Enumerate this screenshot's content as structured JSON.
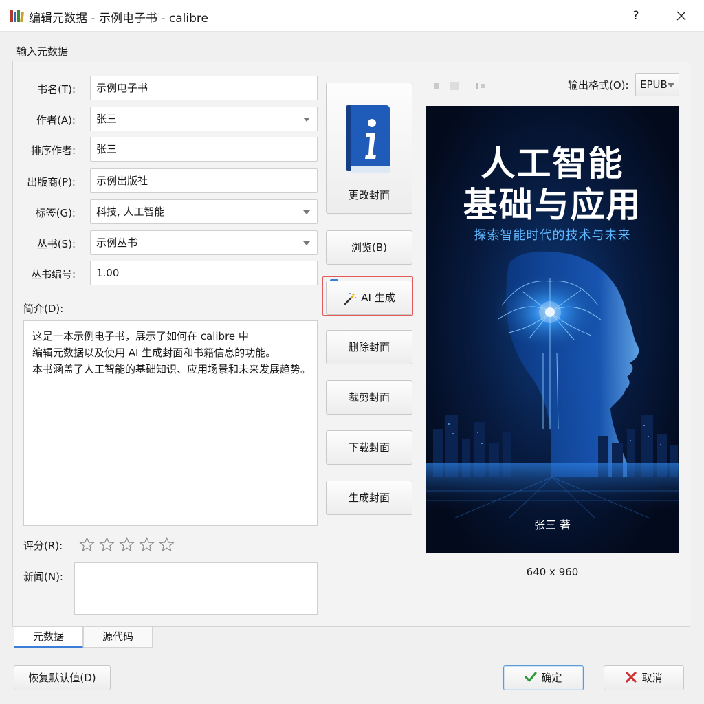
{
  "window": {
    "title": "编辑元数据 - 示例电子书 - calibre",
    "help": "?"
  },
  "section_label": "输入元数据",
  "form": {
    "title_label": "书名(T):",
    "title_value": "示例电子书",
    "author_label": "作者(A):",
    "author_value": "张三",
    "sort_author_label": "排序作者:",
    "sort_author_value": "张三",
    "publisher_label": "出版商(P):",
    "publisher_value": "示例出版社",
    "tags_label": "标签(G):",
    "tags_value": "科技, 人工智能",
    "series_label": "丛书(S):",
    "series_value": "示例丛书",
    "series_index_label": "丛书编号:",
    "series_index_value": "1.00",
    "description_label": "简介(D):",
    "description_lines": [
      "这是一本示例电子书，展示了如何在 calibre 中",
      "编辑元数据以及使用 AI 生成封面和书籍信息的功能。",
      "本书涵盖了人工智能的基础知识、应用场景和未来发展趋势。"
    ],
    "rating_label": "评分(R):",
    "rating": 0,
    "rating_max": 5,
    "news_label": "新闻(N):",
    "news_value": ""
  },
  "cover_buttons": {
    "change_cover": "更改封面",
    "browse": "浏览(B)",
    "ai_generate": "AI 生成",
    "remove_cover": "删除封面",
    "trim_cover": "裁剪封面",
    "download_cover": "下载封面",
    "generate_cover": "生成封面"
  },
  "output_format": {
    "label": "输出格式(O):",
    "value": "EPUB"
  },
  "cover": {
    "title_line1": "人工智能",
    "title_line2": "基础与应用",
    "subtitle": "探索智能时代的技术与未来",
    "author": "张三  著",
    "dimensions": "640 x 960"
  },
  "tabs": [
    {
      "label": "元数据",
      "active": true
    },
    {
      "label": "源代码",
      "active": false
    }
  ],
  "bottom_buttons": {
    "reset": "恢复默认值(D)",
    "ok": "确定",
    "cancel": "取消"
  },
  "colors": {
    "accent": "#3b7dd8",
    "highlight_border": "#e25b5b",
    "cover_background": "#06112a",
    "cover_subtitle": "#5fb8ff",
    "ok_check": "#2e9a3a",
    "cancel_x": "#d03030"
  }
}
